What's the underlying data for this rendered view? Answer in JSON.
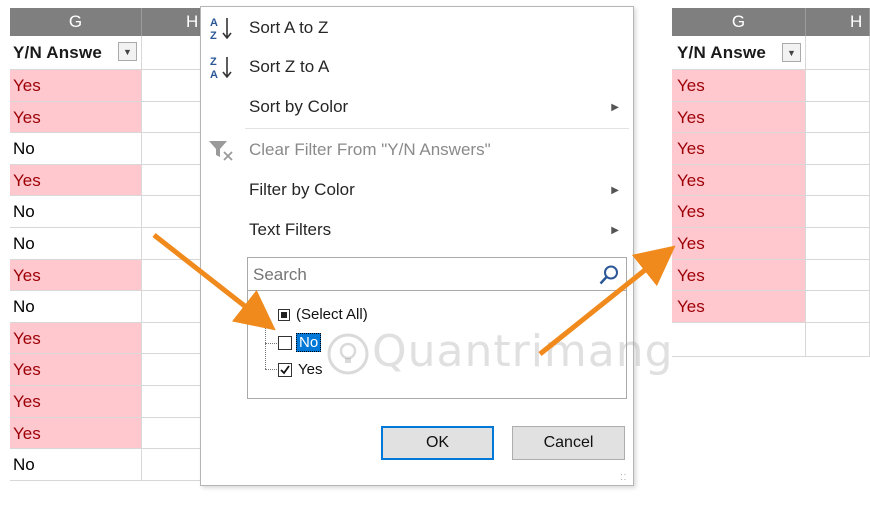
{
  "left_sheet": {
    "columns": [
      {
        "letter": "G"
      },
      {
        "letter": "H"
      }
    ],
    "header_cell": "Y/N Answe",
    "rows": [
      "Yes",
      "Yes",
      "No",
      "Yes",
      "No",
      "No",
      "Yes",
      "No",
      "Yes",
      "Yes",
      "Yes",
      "Yes",
      "No"
    ]
  },
  "filter_menu": {
    "items": [
      {
        "label": "Sort A to Z",
        "icon": "sort-a-to-z-icon",
        "has_submenu": false,
        "disabled": false
      },
      {
        "label": "Sort Z to A",
        "icon": "sort-z-to-a-icon",
        "has_submenu": false,
        "disabled": false
      },
      {
        "label": "Sort by Color",
        "icon": "",
        "has_submenu": true,
        "disabled": false
      },
      {
        "label": "Clear Filter From \"Y/N Answers\"",
        "icon": "clear-filter-icon",
        "has_submenu": false,
        "disabled": true
      },
      {
        "label": "Filter by Color",
        "icon": "",
        "has_submenu": true,
        "disabled": false
      },
      {
        "label": "Text Filters",
        "icon": "",
        "has_submenu": true,
        "disabled": false
      }
    ],
    "search_placeholder": "Search",
    "tree": [
      {
        "label": "(Select All)",
        "state": "indeterminate"
      },
      {
        "label": "No",
        "state": "unchecked"
      },
      {
        "label": "Yes",
        "state": "checked"
      }
    ],
    "ok_label": "OK",
    "cancel_label": "Cancel"
  },
  "right_sheet": {
    "columns": [
      {
        "letter": "G"
      },
      {
        "letter": "H"
      }
    ],
    "header_cell": "Y/N Answe",
    "rows": [
      "Yes",
      "Yes",
      "Yes",
      "Yes",
      "Yes",
      "Yes",
      "Yes",
      "Yes"
    ]
  },
  "watermark": "Quantrimang",
  "colors": {
    "yes_fill": "#ffc7ce",
    "yes_text": "#9c0006",
    "arrow": "#f08a1c",
    "header_bg": "#7f7f7f",
    "ok_border": "#0078d7",
    "selection": "#0078d7"
  }
}
